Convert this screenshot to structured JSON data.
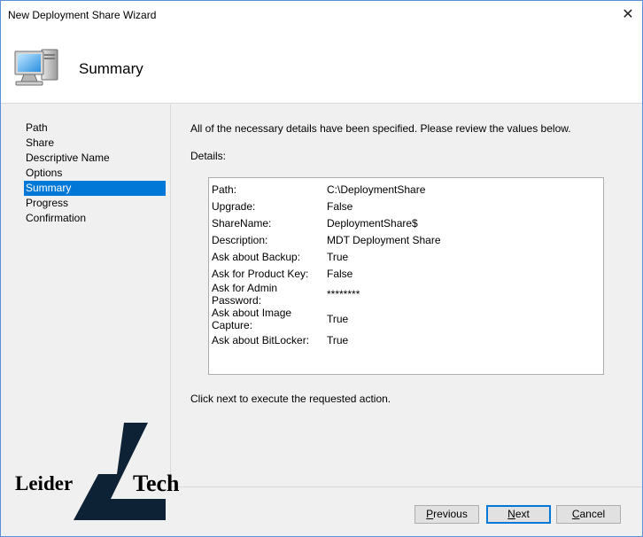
{
  "window": {
    "title": "New Deployment Share Wizard",
    "close_glyph": "✕"
  },
  "header": {
    "title": "Summary",
    "icon": "computer-icon"
  },
  "nav": {
    "items": [
      {
        "label": "Path",
        "active": false
      },
      {
        "label": "Share",
        "active": false
      },
      {
        "label": "Descriptive Name",
        "active": false
      },
      {
        "label": "Options",
        "active": false
      },
      {
        "label": "Summary",
        "active": true
      },
      {
        "label": "Progress",
        "active": false
      },
      {
        "label": "Confirmation",
        "active": false
      }
    ]
  },
  "main": {
    "intro": "All of the necessary details have been specified.  Please review the values below.",
    "details_label": "Details:",
    "details": [
      {
        "key": "Path:",
        "value": "C:\\DeploymentShare"
      },
      {
        "key": "Upgrade:",
        "value": "False"
      },
      {
        "key": "ShareName:",
        "value": "DeploymentShare$"
      },
      {
        "key": "Description:",
        "value": "MDT Deployment Share"
      },
      {
        "key": "Ask about Backup:",
        "value": "True"
      },
      {
        "key": "Ask for Product Key:",
        "value": "False"
      },
      {
        "key": "Ask for Admin Password:",
        "value": "********"
      },
      {
        "key": "Ask about Image Capture:",
        "value": "True"
      },
      {
        "key": "Ask about BitLocker:",
        "value": "True"
      }
    ],
    "footer_note": "Click next to execute the requested action."
  },
  "buttons": {
    "previous": {
      "label": "Previous",
      "accel_index": 0
    },
    "next": {
      "label": "Next",
      "accel_index": 0
    },
    "cancel": {
      "label": "Cancel",
      "accel_index": 0
    }
  },
  "watermark": {
    "word1": "Leider",
    "word2": "Tech",
    "color": "#0d2235"
  },
  "colors": {
    "selection": "#0078d7",
    "window_border": "#5a8fd6"
  }
}
